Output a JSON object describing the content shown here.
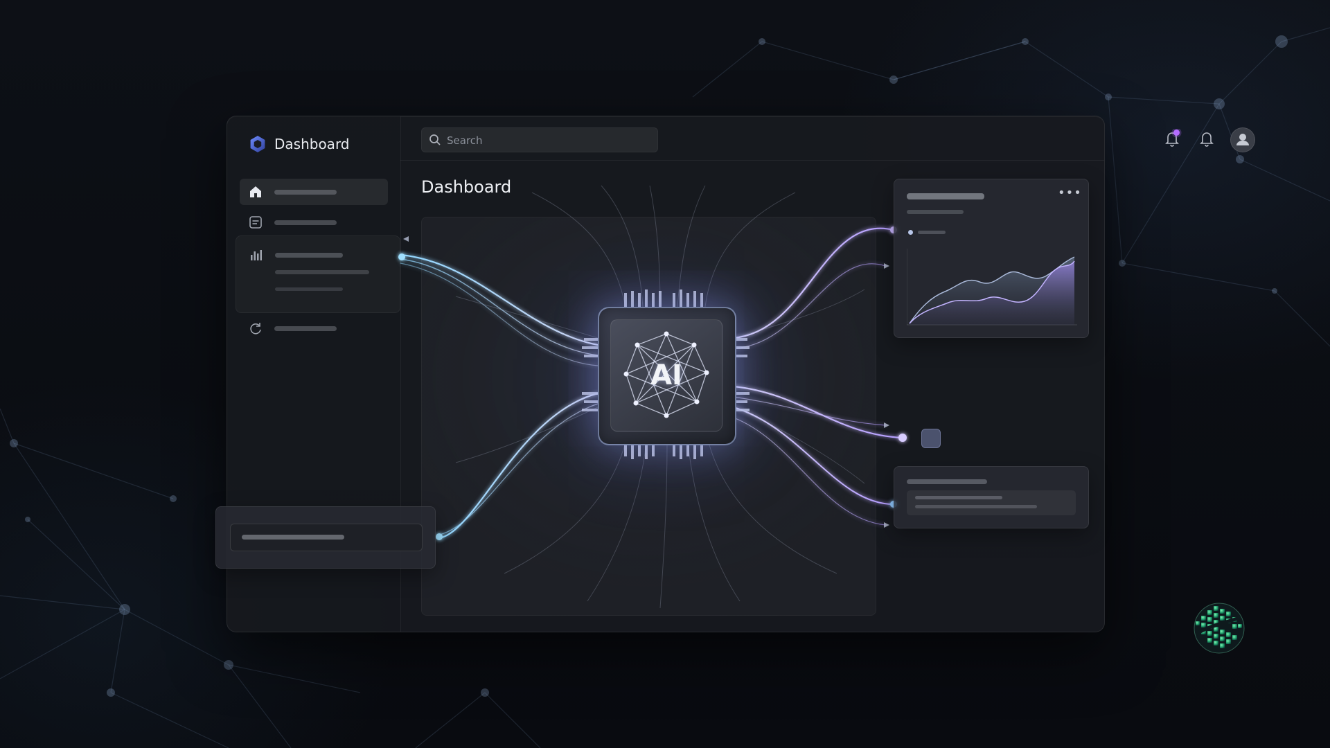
{
  "app": {
    "brand_title": "Dashboard"
  },
  "header": {
    "search_placeholder": "Search"
  },
  "main": {
    "page_title": "Dashboard",
    "chip_label": "AI"
  },
  "icons": {
    "logo": "hexagon-logo-icon",
    "search": "search-icon",
    "notification_badge": "notification-bell-with-badge-icon",
    "bell": "bell-icon",
    "user": "user-icon",
    "home": "home-icon",
    "document": "document-icon",
    "analytics": "bar-chart-icon",
    "settings": "cycle-icon",
    "more": "more-horizontal-icon"
  },
  "colors": {
    "accent_blue": "#7fd0ff",
    "accent_purple": "#a68cff",
    "badge": "#b56cff",
    "panel": "#18191f"
  }
}
